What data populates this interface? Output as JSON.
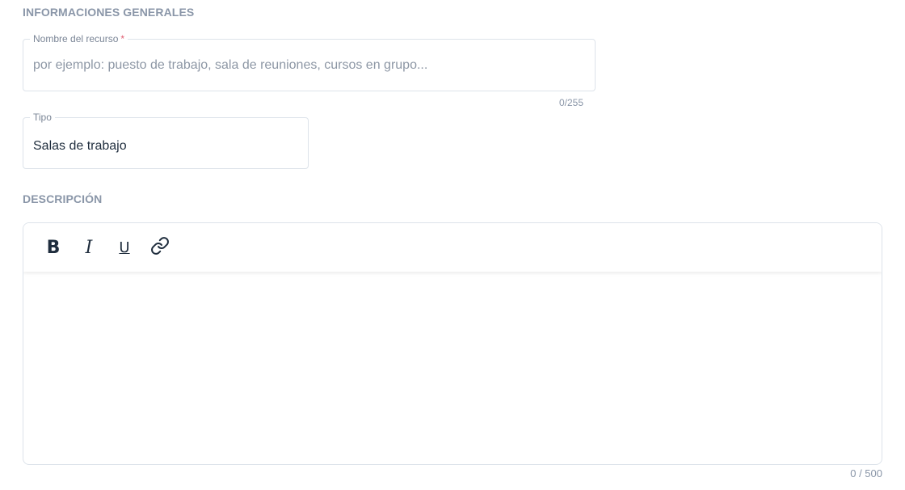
{
  "sections": {
    "general_title": "INFORMACIONES GENERALES",
    "description_title": "DESCRIPCIÓN"
  },
  "name_field": {
    "label": "Nombre del recurso",
    "required_mark": "*",
    "value": "",
    "placeholder": "por ejemplo: puesto de trabajo, sala de reuniones, cursos en grupo...",
    "counter": "0/255"
  },
  "type_field": {
    "label": "Tipo",
    "value": "Salas de trabajo"
  },
  "editor": {
    "toolbar": {
      "bold_label": "B",
      "italic_label": "I",
      "underline_label": "U",
      "link_icon": "link-icon"
    },
    "content": "",
    "counter": "0 / 500"
  },
  "colors": {
    "section_title": "#8a96a8",
    "border": "#dde3ea",
    "required": "#e05b6f",
    "text": "#1f2d3d"
  }
}
